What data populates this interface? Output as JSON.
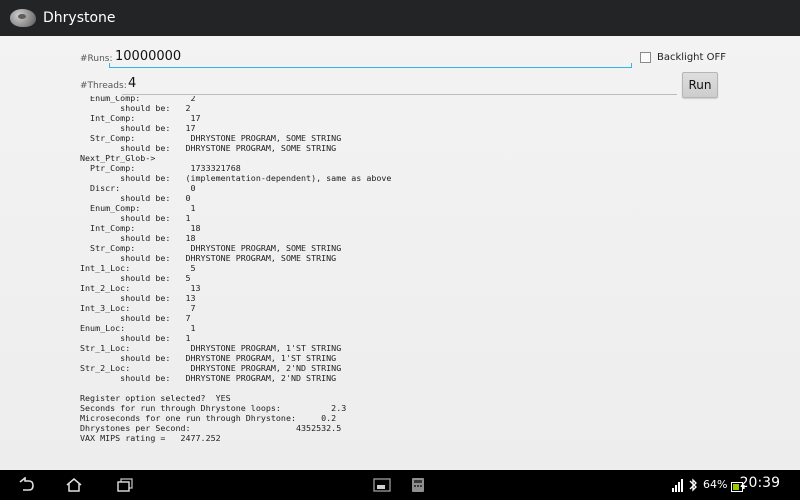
{
  "app": {
    "title": "Dhrystone",
    "icon": "stone-icon"
  },
  "form": {
    "runs_label": "#Runs:",
    "runs_value": "10000000",
    "threads_label": "#Threads:",
    "threads_value": "4",
    "backlight_label": "Backlight OFF",
    "backlight_checked": false,
    "run_button": "Run"
  },
  "output_lines": [
    "  Enum_Comp:          2",
    "        should be:   2",
    "  Int_Comp:           17",
    "        should be:   17",
    "  Str_Comp:           DHRYSTONE PROGRAM, SOME STRING",
    "        should be:   DHRYSTONE PROGRAM, SOME STRING",
    "Next_Ptr_Glob->",
    "  Ptr_Comp:           1733321768",
    "        should be:   (implementation-dependent), same as above",
    "  Discr:              0",
    "        should be:   0",
    "  Enum_Comp:          1",
    "        should be:   1",
    "  Int_Comp:           18",
    "        should be:   18",
    "  Str_Comp:           DHRYSTONE PROGRAM, SOME STRING",
    "        should be:   DHRYSTONE PROGRAM, SOME STRING",
    "Int_1_Loc:            5",
    "        should be:   5",
    "Int_2_Loc:            13",
    "        should be:   13",
    "Int_3_Loc:            7",
    "        should be:   7",
    "Enum_Loc:             1",
    "        should be:   1",
    "Str_1_Loc:            DHRYSTONE PROGRAM, 1'ST STRING",
    "        should be:   DHRYSTONE PROGRAM, 1'ST STRING",
    "Str_2_Loc:            DHRYSTONE PROGRAM, 2'ND STRING",
    "        should be:   DHRYSTONE PROGRAM, 2'ND STRING",
    "",
    "Register option selected?  YES",
    "Seconds for run through Dhrystone loops:          2.3",
    "Microseconds for one run through Dhrystone:     0.2",
    "Dhrystones per Second:                     4352532.5",
    "VAX MIPS rating =   2477.252"
  ],
  "status_bar": {
    "battery": "64%",
    "time": "20:39",
    "icons": [
      "back-icon",
      "home-icon",
      "recent-apps-icon",
      "small-apps-icon",
      "keyboard-icon",
      "lte-signal-icon",
      "bluetooth-icon",
      "battery-icon"
    ]
  },
  "colors": {
    "accent": "#33b5e5",
    "actionbar": "#222426",
    "navbar": "#000000"
  }
}
